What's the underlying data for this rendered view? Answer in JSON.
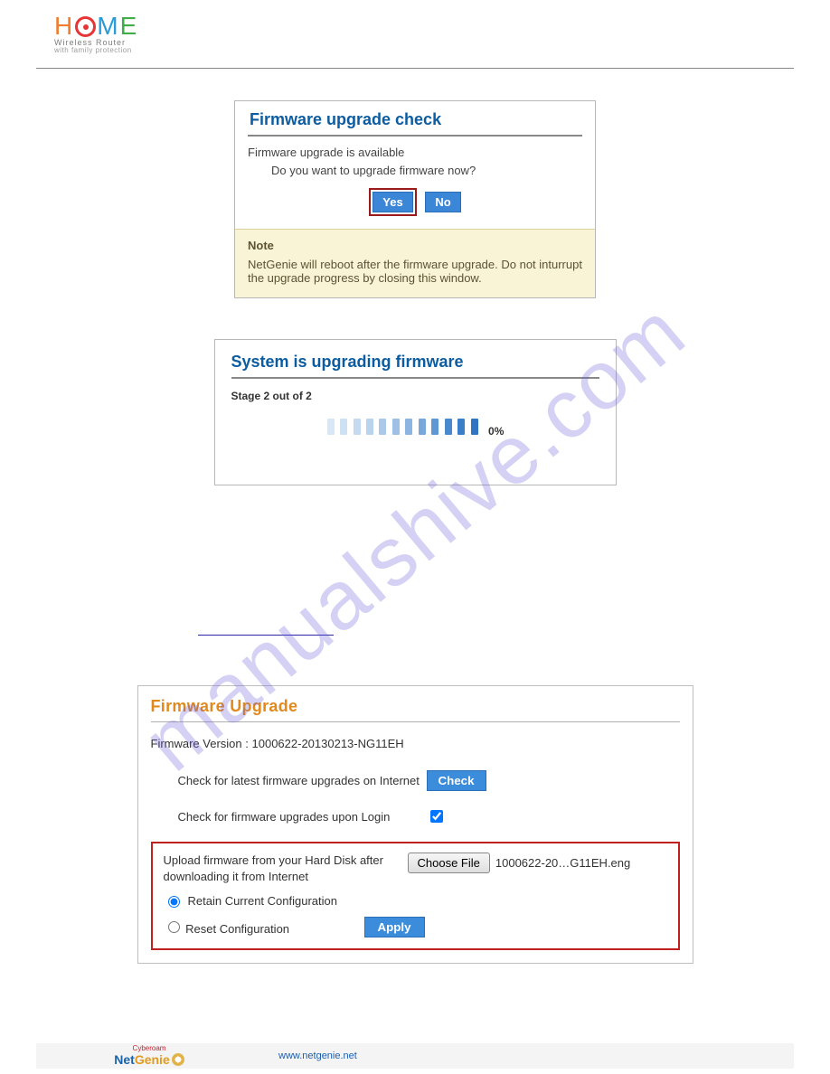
{
  "header": {
    "logo_sub1": "Wireless Router",
    "logo_sub2": "with family protection"
  },
  "dialog_check": {
    "title": "Firmware upgrade check",
    "line1": "Firmware upgrade is available",
    "line2": "Do you want to upgrade firmware now?",
    "yes": "Yes",
    "no": "No",
    "note_label": "Note",
    "note_text": "NetGenie will reboot after the firmware upgrade. Do not inturrupt the upgrade progress by closing this window."
  },
  "dialog_progress": {
    "title": "System is upgrading firmware",
    "stage": "Stage 2 out of 2",
    "percent": "0%"
  },
  "panel": {
    "title": "Firmware Upgrade",
    "version_label": "Firmware Version :",
    "version_value": "1000622-20130213-NG11EH",
    "check_label": "Check for latest firmware upgrades on Internet",
    "check_btn": "Check",
    "login_check_label": "Check for firmware upgrades upon Login",
    "upload_label": "Upload firmware from your Hard Disk after downloading it from Internet",
    "choose_btn": "Choose File",
    "chosen_file": "1000622-20…G11EH.eng",
    "opt_retain": "Retain Current Configuration",
    "opt_reset": "Reset Configuration",
    "apply_btn": "Apply"
  },
  "footer": {
    "brand_small": "Cyberoam",
    "brand": "NetGenie",
    "url": "www.netgenie.net"
  },
  "watermark": "manualshive.com"
}
